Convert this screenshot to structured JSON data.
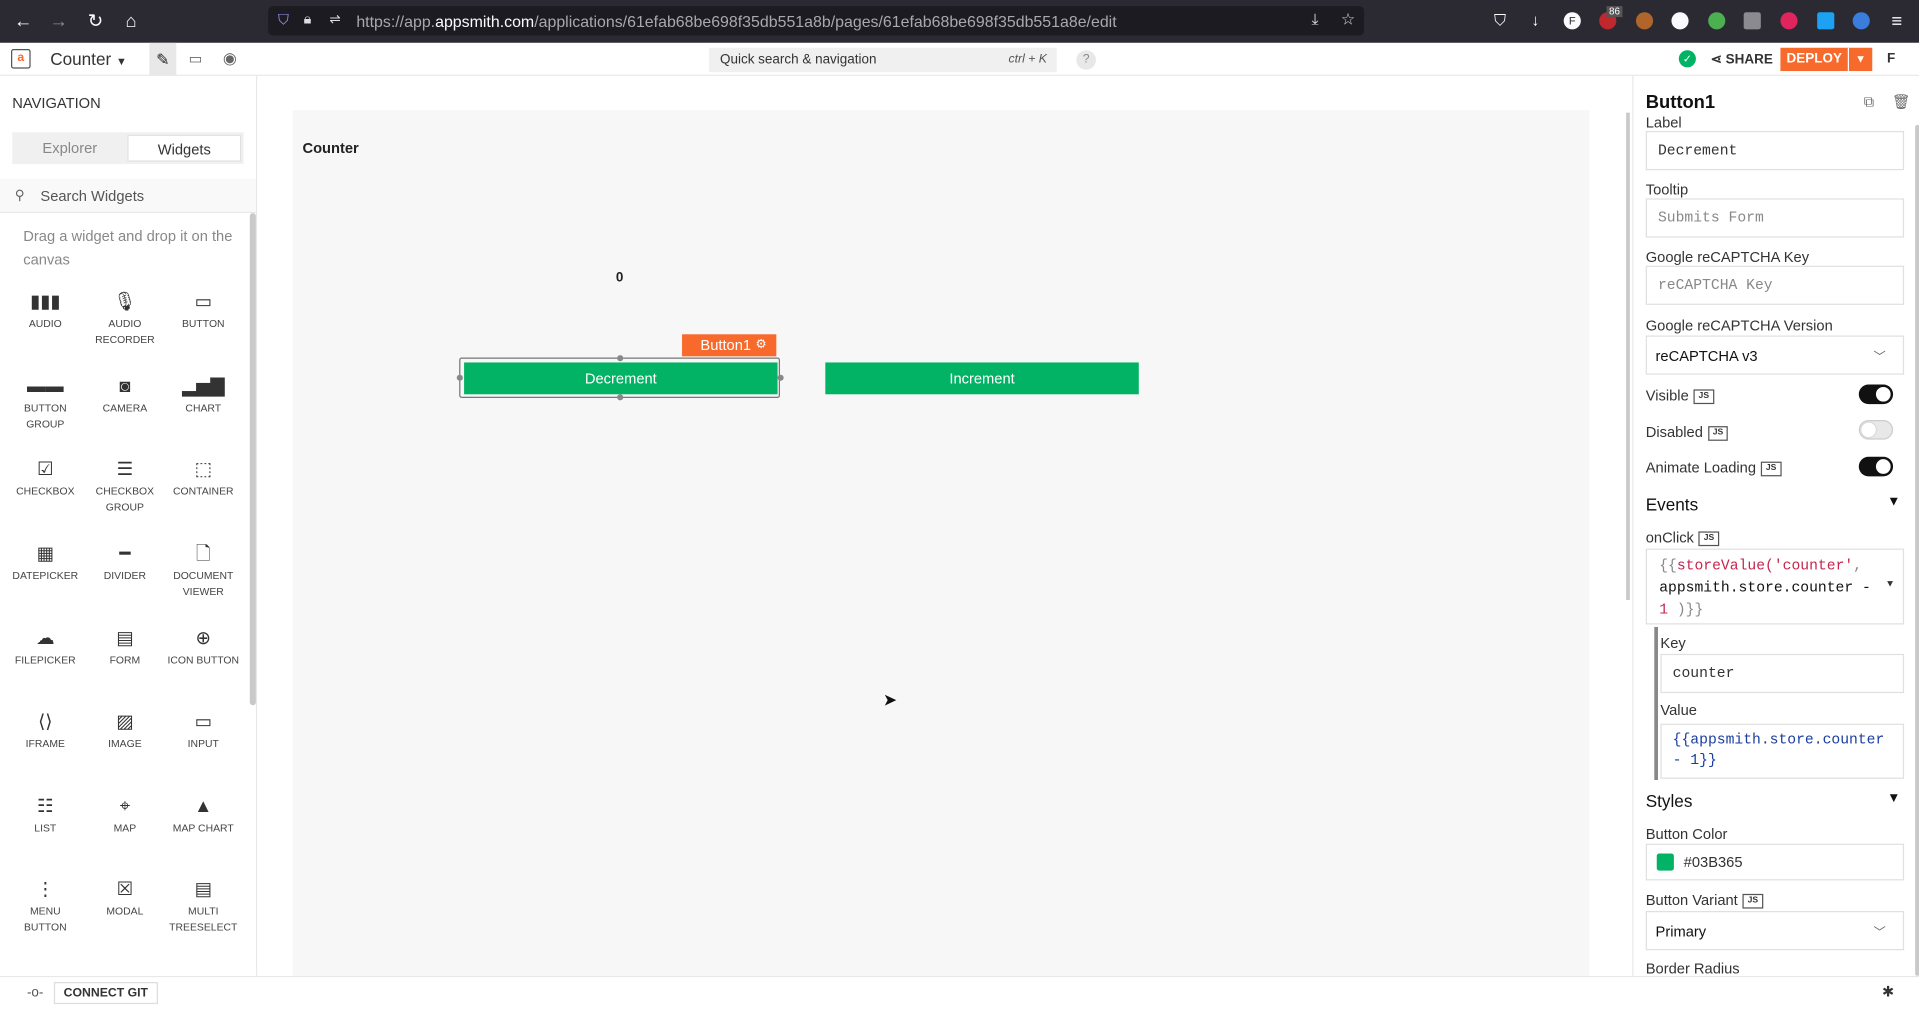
{
  "browser": {
    "url_prefix": "https://app.",
    "url_domain": "appsmith.com",
    "url_path": "/applications/61efab68be698f35db551a8b/pages/61efab68be698f35db551a8e/edit",
    "ext_badge": "86"
  },
  "header": {
    "app_name": "Counter",
    "search_placeholder": "Quick search & navigation",
    "search_shortcut": "ctrl + K",
    "help": "?",
    "share_label": "SHARE",
    "deploy_label": "DEPLOY",
    "avatar": "F"
  },
  "sidebar": {
    "title": "NAVIGATION",
    "tabs": [
      "Explorer",
      "Widgets"
    ],
    "search_placeholder": "Search Widgets",
    "hint": "Drag a widget and drop it on the canvas",
    "widgets": [
      {
        "label": "AUDIO",
        "icon": "audio-icon"
      },
      {
        "label": "AUDIO RECORDER",
        "icon": "microphone-icon"
      },
      {
        "label": "BUTTON",
        "icon": "button-icon"
      },
      {
        "label": "BUTTON GROUP",
        "icon": "button-group-icon"
      },
      {
        "label": "CAMERA",
        "icon": "camera-icon"
      },
      {
        "label": "CHART",
        "icon": "chart-icon"
      },
      {
        "label": "CHECKBOX",
        "icon": "checkbox-icon"
      },
      {
        "label": "CHECKBOX GROUP",
        "icon": "checkbox-group-icon"
      },
      {
        "label": "CONTAINER",
        "icon": "container-icon"
      },
      {
        "label": "DATEPICKER",
        "icon": "calendar-icon"
      },
      {
        "label": "DIVIDER",
        "icon": "divider-icon"
      },
      {
        "label": "DOCUMENT VIEWER",
        "icon": "document-icon"
      },
      {
        "label": "FILEPICKER",
        "icon": "cloud-upload-icon"
      },
      {
        "label": "FORM",
        "icon": "form-icon"
      },
      {
        "label": "ICON BUTTON",
        "icon": "plus-circle-icon"
      },
      {
        "label": "IFRAME",
        "icon": "iframe-icon"
      },
      {
        "label": "IMAGE",
        "icon": "image-icon"
      },
      {
        "label": "INPUT",
        "icon": "input-icon"
      },
      {
        "label": "LIST",
        "icon": "list-icon"
      },
      {
        "label": "MAP",
        "icon": "map-pin-icon"
      },
      {
        "label": "MAP CHART",
        "icon": "map-chart-icon"
      },
      {
        "label": "MENU BUTTON",
        "icon": "menu-dots-icon"
      },
      {
        "label": "MODAL",
        "icon": "modal-icon"
      },
      {
        "label": "MULTI TREESELECT",
        "icon": "treeselect-icon"
      }
    ]
  },
  "canvas": {
    "page_label": "Counter",
    "counter_value": "0",
    "selected_tag": "Button1",
    "decrement_label": "Decrement",
    "increment_label": "Increment"
  },
  "props": {
    "widget_name": "Button1",
    "label_title": "Label",
    "label_value": "Decrement",
    "tooltip_title": "Tooltip",
    "tooltip_placeholder": "Submits Form",
    "recaptcha_key_title": "Google reCAPTCHA Key",
    "recaptcha_key_placeholder": "reCAPTCHA Key",
    "recaptcha_version_title": "Google reCAPTCHA Version",
    "recaptcha_version_value": "reCAPTCHA v3",
    "js_badge": "JS",
    "visible_title": "Visible",
    "visible_on": true,
    "disabled_title": "Disabled",
    "disabled_on": false,
    "animate_title": "Animate Loading",
    "animate_on": true,
    "events_title": "Events",
    "onclick_title": "onClick",
    "onclick_code": {
      "open": "{{",
      "fn": "storeValue(",
      "arg1": "'counter'",
      "comma": ",",
      "expr": "appsmith.store.counter -",
      "num": "1",
      "close": " )}}"
    },
    "key_title": "Key",
    "key_value": "counter",
    "value_title": "Value",
    "value_code": "{{appsmith.store.counter - 1}}",
    "styles_title": "Styles",
    "button_color_title": "Button Color",
    "button_color_value": "#03B365",
    "button_variant_title": "Button Variant",
    "button_variant_value": "Primary",
    "border_radius_title": "Border Radius"
  },
  "bottombar": {
    "connect_git": "CONNECT GIT"
  },
  "colors": {
    "brand_orange": "#F86A2B",
    "button_green": "#03B365"
  }
}
